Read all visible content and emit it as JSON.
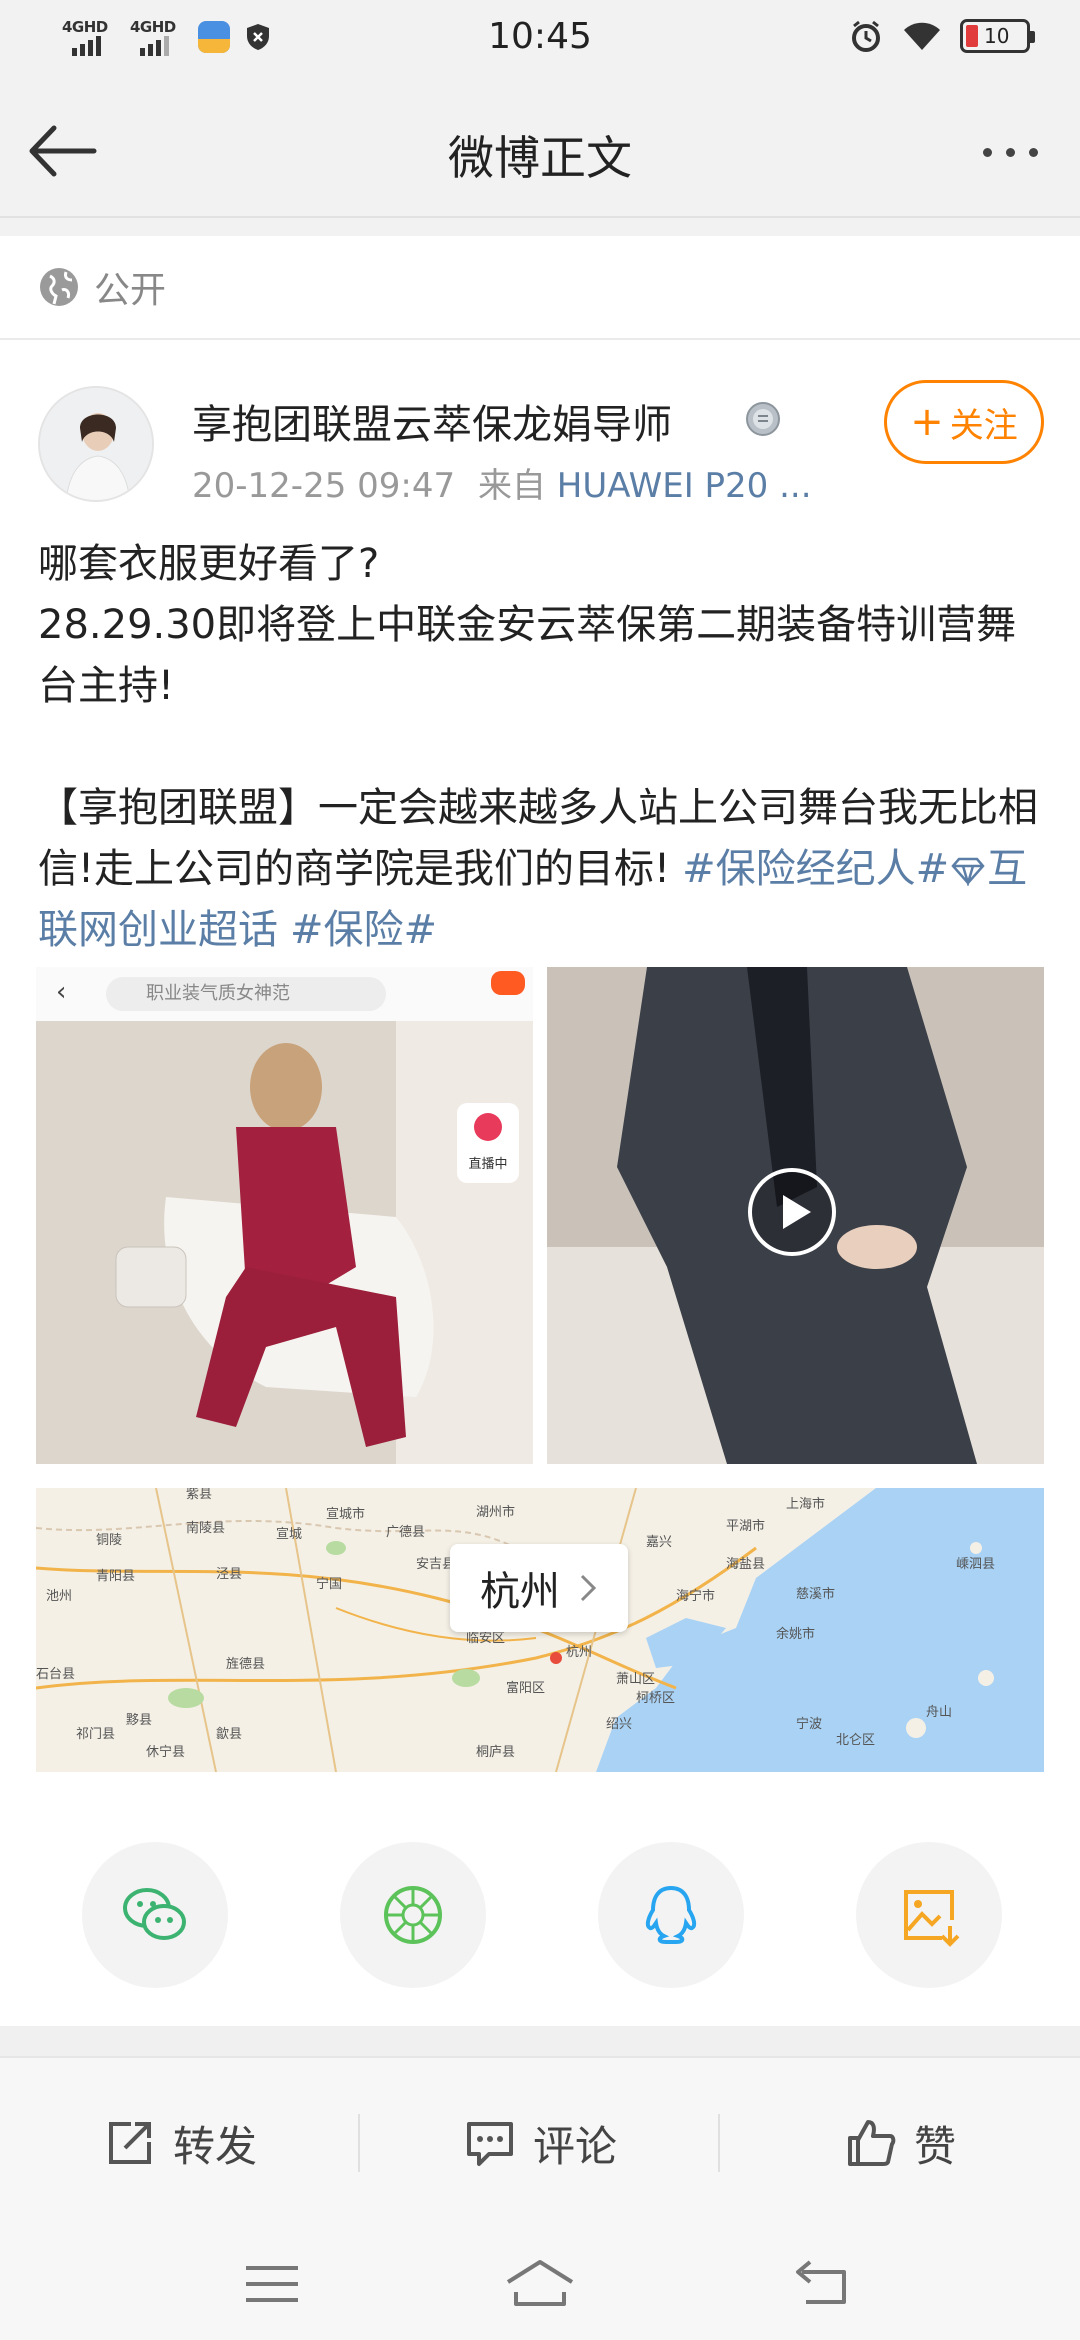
{
  "status_bar": {
    "time": "10:45",
    "signal1": "4GHD",
    "signal2": "4GHD",
    "battery": "10",
    "battery_color": "#e23b3b"
  },
  "header": {
    "title": "微博正文",
    "back_icon": "arrow-left-icon",
    "more_icon": "more-horizontal-icon"
  },
  "visibility": {
    "icon": "globe-icon",
    "label": "公开"
  },
  "post": {
    "author": "享抱团联盟云萃保龙娟导师",
    "badge_icon": "medal-icon",
    "datetime": "20-12-25 09:47",
    "source_prefix": "来自",
    "source": "HUAWEI P20 ...",
    "follow_label": "关注",
    "text_lines": [
      "哪套衣服更好看了?",
      "28.29.30即将登上中联金安云萃保第二期装备特训营舞台主持!",
      "",
      "【享抱团联盟】一定会越来越多人站上公司舞台我无比相信!走上公司的商学院是我们的目标!"
    ],
    "tags": [
      "#保险经纪人#",
      "互联网创业超话",
      "#保险#"
    ],
    "image1": {
      "search_text": "职业装气质女神范",
      "live_label": "直播中"
    },
    "location": {
      "city": "杭州",
      "map_labels": [
        "紫县",
        "铜陵",
        "南陵县",
        "宣城",
        "宣城市",
        "广德县",
        "湖州市",
        "嘉兴",
        "平湖市",
        "上海市",
        "青阳县",
        "泾县",
        "池州",
        "宁国",
        "安吉县",
        "杭州",
        "海宁市",
        "海盐县",
        "慈溪市",
        "余姚市",
        "石台县",
        "旌德县",
        "临安区",
        "富阳区",
        "萧山区",
        "绍兴",
        "宁波",
        "祁门县",
        "黟县",
        "歙县",
        "休宁县",
        "桐庐县",
        "柯桥区",
        "北仑区",
        "舟山",
        "嵊泗县"
      ]
    },
    "brand_color": "#ff8200",
    "link_color": "#5b7ea6"
  },
  "share": [
    {
      "name": "wechat",
      "icon": "wechat-icon",
      "color": "#3cb371"
    },
    {
      "name": "moments",
      "icon": "moments-icon",
      "color": "#5cc35a"
    },
    {
      "name": "qq",
      "icon": "qq-icon",
      "color": "#27a5f0"
    },
    {
      "name": "save-image",
      "icon": "save-image-icon",
      "color": "#f5a623"
    }
  ],
  "actions": {
    "repost": "转发",
    "comment": "评论",
    "like": "赞"
  },
  "nav": {
    "menu_icon": "menu-icon",
    "home_icon": "home-icon",
    "back_icon": "back-icon"
  }
}
